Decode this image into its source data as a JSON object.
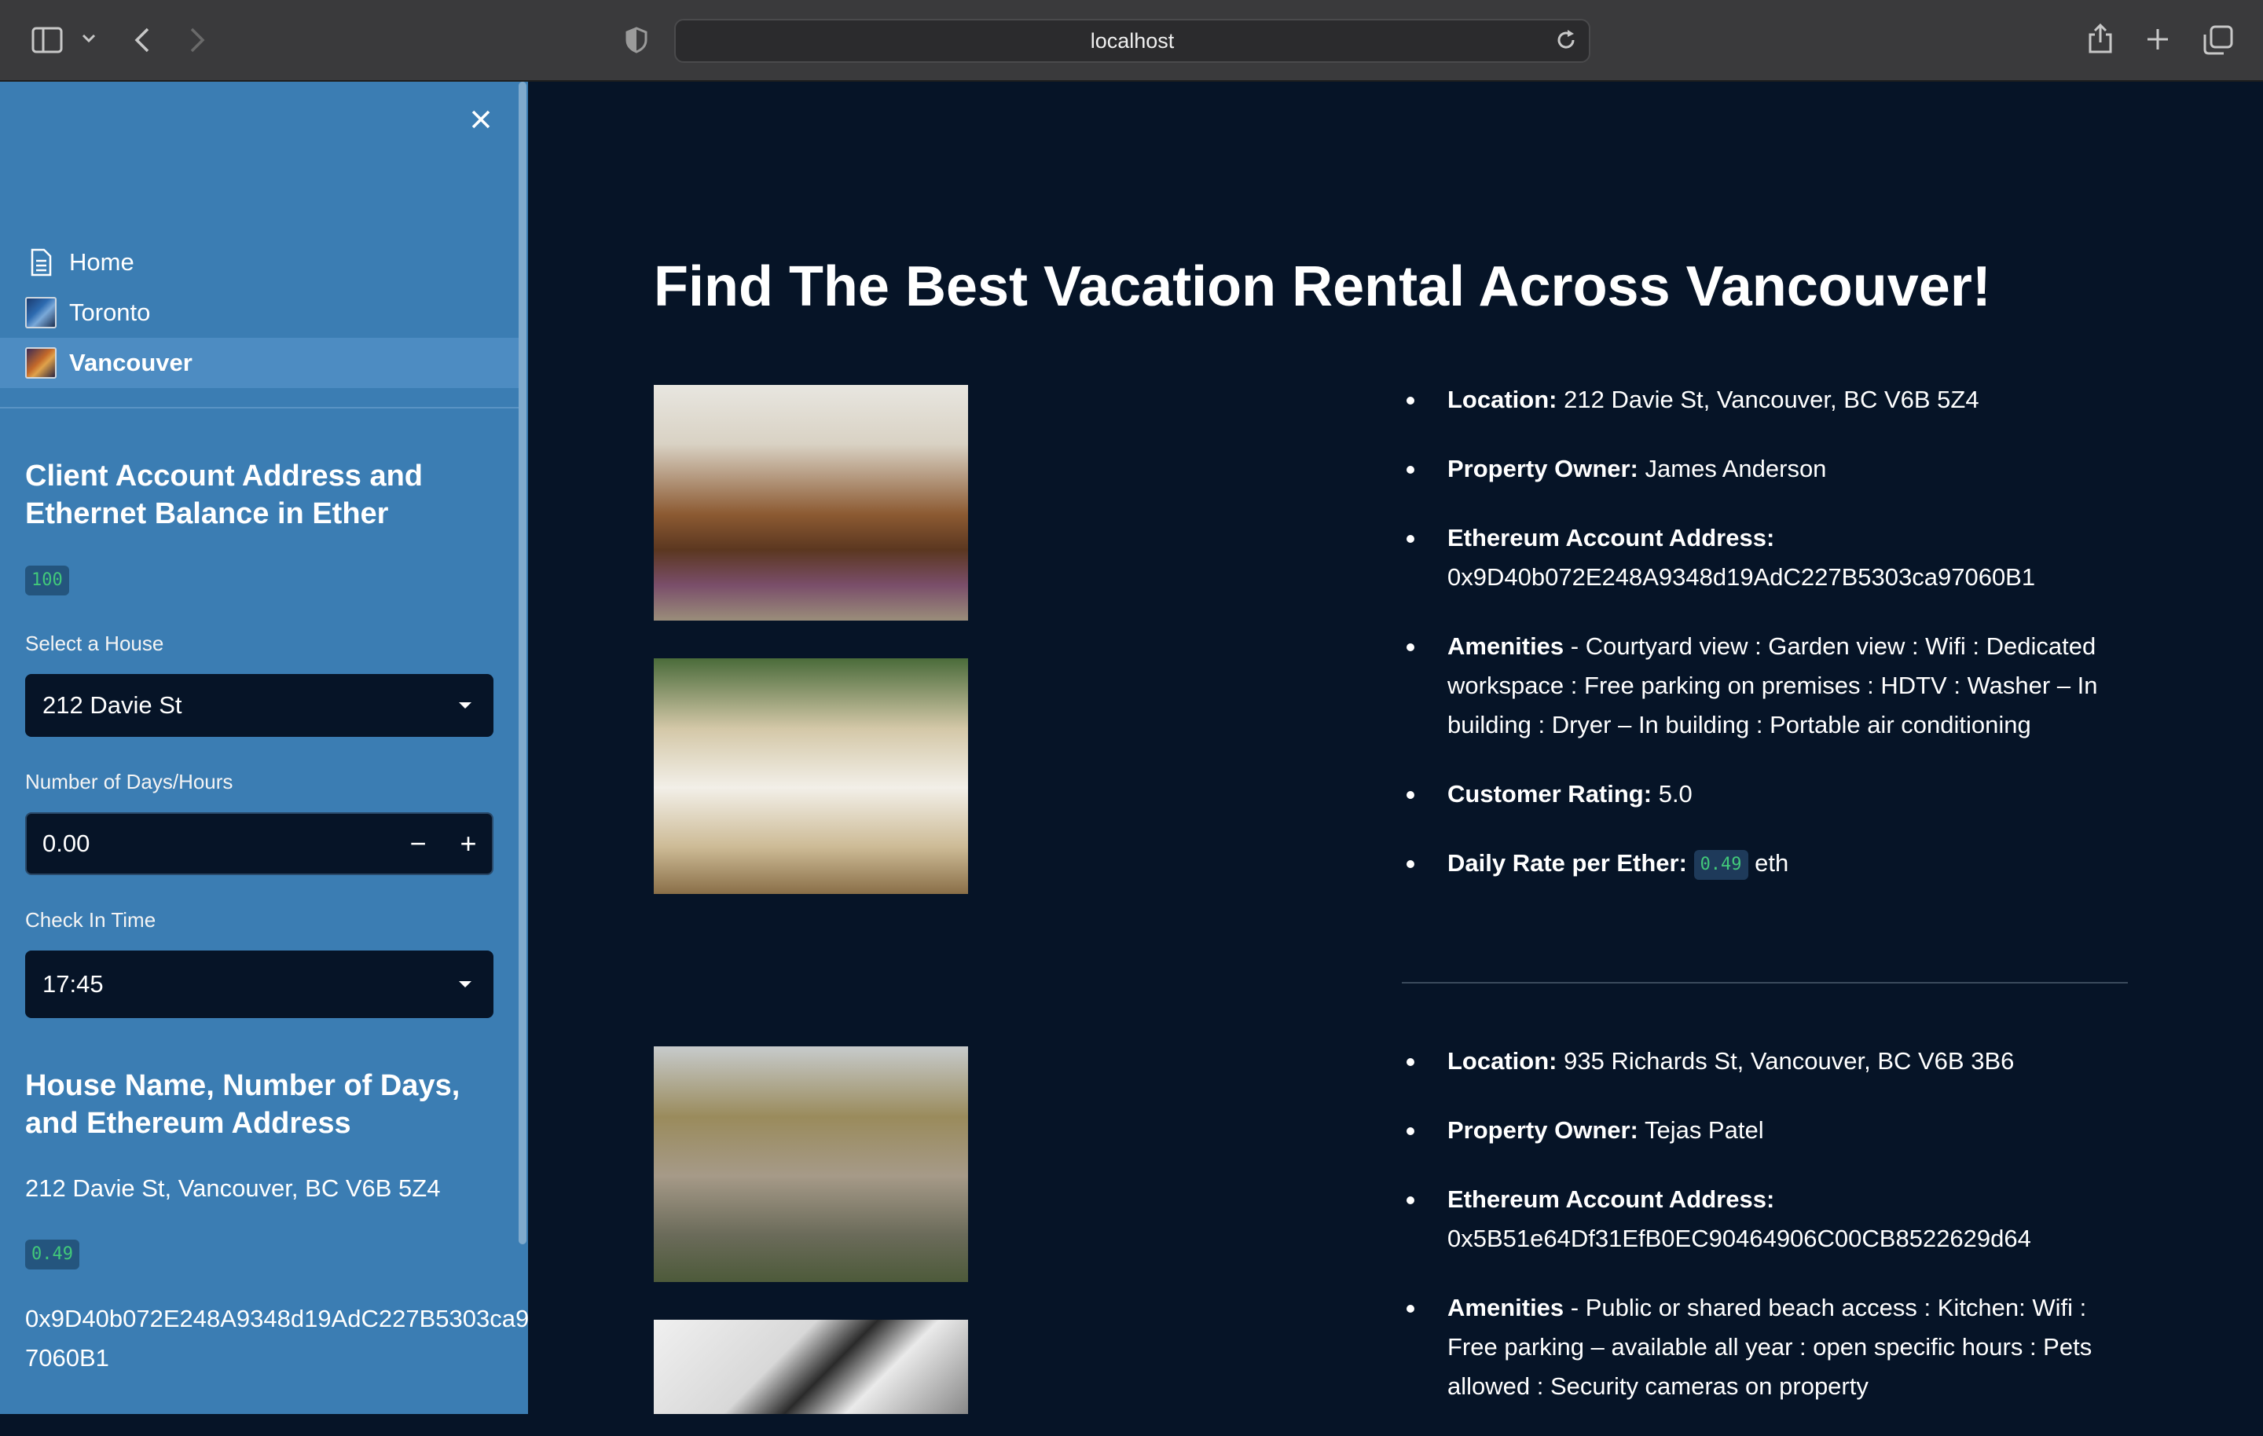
{
  "browser": {
    "url": "localhost"
  },
  "sidebar": {
    "nav": [
      {
        "label": "Home"
      },
      {
        "label": "Toronto"
      },
      {
        "label": "Vancouver"
      }
    ],
    "account_heading": "Client Account Address and Ethernet Balance in Ether",
    "balance": "100",
    "select_house_label": "Select a House",
    "select_house_value": "212 Davie St",
    "days_label": "Number of Days/Hours",
    "days_value": "0.00",
    "checkin_label": "Check In Time",
    "checkin_value": "17:45",
    "summary_heading": "House Name, Number of Days, and Ethereum Address",
    "summary_address": "212 Davie St, Vancouver, BC V6B 5Z4",
    "summary_rate": "0.49",
    "summary_eth_line1": "0x9D40b072E248A9348d19AdC227B5303ca9",
    "summary_eth_line2": "7060B1"
  },
  "main": {
    "title": "Find The Best Vacation Rental Across Vancouver!",
    "listings": [
      {
        "location_label": "Location:",
        "location": "212 Davie St, Vancouver, BC V6B 5Z4",
        "owner_label": "Property Owner:",
        "owner": "James Anderson",
        "eth_label": "Ethereum Account Address:",
        "eth": "0x9D40b072E248A9348d19AdC227B5303ca97060B1",
        "amenities_label": "Amenities",
        "amenities": "- Courtyard view : Garden view : Wifi : Dedicated workspace : Free parking on premises : HDTV : Washer – In building : Dryer – In building : Portable air conditioning",
        "rating_label": "Customer Rating:",
        "rating": "5.0",
        "rate_label": "Daily Rate per Ether:",
        "rate": "0.49",
        "rate_unit": "eth"
      },
      {
        "location_label": "Location:",
        "location": "935 Richards St, Vancouver, BC V6B 3B6",
        "owner_label": "Property Owner:",
        "owner": "Tejas Patel",
        "eth_label": "Ethereum Account Address:",
        "eth": "0x5B51e64Df31EfB0EC90464906C00CB8522629d64",
        "amenities_label": "Amenities",
        "amenities": "- Public or shared beach access : Kitchen: Wifi : Free parking – available all year : open specific hours : Pets allowed : Security cameras on property"
      }
    ]
  }
}
